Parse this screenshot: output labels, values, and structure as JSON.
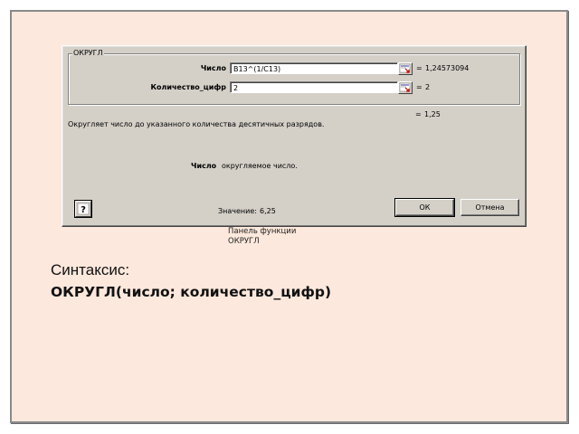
{
  "dialog": {
    "group_title": "ОКРУГЛ",
    "args": [
      {
        "label": "Число",
        "value": "B13^(1/C13)",
        "result": "1,24573094"
      },
      {
        "label": "Количество_цифр",
        "value": "2",
        "result": "2"
      }
    ],
    "eq_sign": "=",
    "total_result": "1,25",
    "description": "Округляет число до указанного количества десятичных разрядов.",
    "arg_help_name": "Число",
    "arg_help_text": "округляемое число.",
    "value_label": "Значение:",
    "value": "6,25",
    "ok_label": "ОК",
    "cancel_label": "Отмена",
    "help_symbol": "?"
  },
  "caption_line1": "Панель функции",
  "caption_line2": "ОКРУГЛ",
  "syntax_label": "Синтаксис:",
  "syntax_formula": "ОКРУГЛ(число; количество_цифр)"
}
